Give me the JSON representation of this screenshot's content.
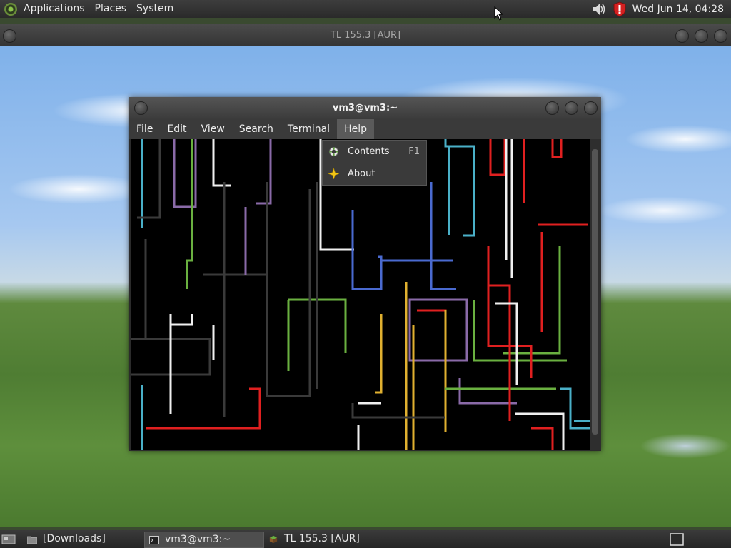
{
  "top_panel": {
    "menus": [
      "Applications",
      "Places",
      "System"
    ],
    "clock": "Wed Jun 14, 04:28",
    "icons": [
      "distro-logo-icon",
      "volume-icon",
      "shield-icon"
    ]
  },
  "back_window": {
    "title": "TL 155.3 [AUR]"
  },
  "terminal": {
    "title": "vm3@vm3:~",
    "menu": [
      "File",
      "Edit",
      "View",
      "Search",
      "Terminal",
      "Help"
    ]
  },
  "help_menu": {
    "items": [
      {
        "label": "Contents",
        "accel": "F1",
        "icon": "lifebuoy-icon"
      },
      {
        "label": "About",
        "accel": "",
        "icon": "star-icon"
      }
    ]
  },
  "taskbar": {
    "tasks": [
      "[Downloads]",
      "vm3@vm3:~",
      "TL 155.3 [AUR]"
    ]
  },
  "colors": {
    "panel": "#2f2f2f",
    "terminal_bg": "#000000",
    "pipe_colors": [
      "#e02020",
      "#4ab0c8",
      "#8a6aa8",
      "#e0b030",
      "#6ab040",
      "#f0f0f0",
      "#3a3a3a",
      "#4a6ad0"
    ]
  }
}
